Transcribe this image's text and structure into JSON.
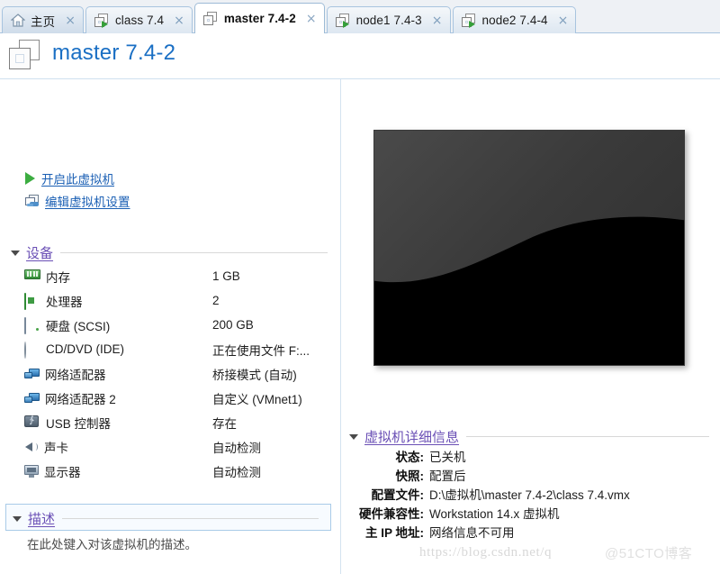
{
  "tabs": [
    {
      "label": "主页",
      "icon": "home-icon",
      "active": false,
      "type": "home",
      "close": "×"
    },
    {
      "label": "class 7.4",
      "icon": "vm-running-icon",
      "active": false,
      "type": "vm-running",
      "close": "×"
    },
    {
      "label": "master 7.4-2",
      "icon": "vm-icon",
      "active": true,
      "type": "vm",
      "close": "×"
    },
    {
      "label": "node1 7.4-3",
      "icon": "vm-running-icon",
      "active": false,
      "type": "vm-running",
      "close": "×"
    },
    {
      "label": "node2 7.4-4",
      "icon": "vm-running-icon",
      "active": false,
      "type": "vm-running",
      "close": "×"
    }
  ],
  "header": {
    "title": "master 7.4-2",
    "icon": "vm-icon",
    "title_color": "#1a6fc4"
  },
  "actions": [
    {
      "label": "开启此虚拟机",
      "icon": "play-icon"
    },
    {
      "label": "编辑虚拟机设置",
      "icon": "settings-icon"
    }
  ],
  "devices_section": {
    "title": "设备",
    "expanded": true,
    "title_color": "#6a4fb5",
    "rows": [
      {
        "name": "内存",
        "value": "1 GB",
        "icon": "memory-icon"
      },
      {
        "name": "处理器",
        "value": "2",
        "icon": "cpu-icon"
      },
      {
        "name": "硬盘 (SCSI)",
        "value": "200 GB",
        "icon": "harddisk-icon"
      },
      {
        "name": "CD/DVD (IDE)",
        "value": "正在使用文件 F:...",
        "icon": "cddvd-icon"
      },
      {
        "name": "网络适配器",
        "value": "桥接模式 (自动)",
        "icon": "network-icon"
      },
      {
        "name": "网络适配器 2",
        "value": "自定义 (VMnet1)",
        "icon": "network-icon"
      },
      {
        "name": "USB 控制器",
        "value": "存在",
        "icon": "usb-icon"
      },
      {
        "name": "声卡",
        "value": "自动检测",
        "icon": "sound-icon"
      },
      {
        "name": "显示器",
        "value": "自动检测",
        "icon": "display-icon"
      }
    ]
  },
  "description_section": {
    "title": "描述",
    "expanded": true,
    "placeholder": "在此处键入对该虚拟机的描述。"
  },
  "details_section": {
    "title": "虚拟机详细信息",
    "expanded": true,
    "rows": [
      {
        "label": "状态:",
        "value": "已关机"
      },
      {
        "label": "快照:",
        "value": "配置后"
      },
      {
        "label": "配置文件:",
        "value": "D:\\虚拟机\\master 7.4-2\\class 7.4.vmx"
      },
      {
        "label": "硬件兼容性:",
        "value": "Workstation 14.x 虚拟机"
      },
      {
        "label": "主 IP 地址:",
        "value": "网络信息不可用"
      }
    ]
  },
  "preview": {
    "alt": "virtual-machine-screen-thumbnail"
  },
  "watermarks": {
    "url": "https://blog.csdn.net/q",
    "site": "@51CTO博客"
  }
}
